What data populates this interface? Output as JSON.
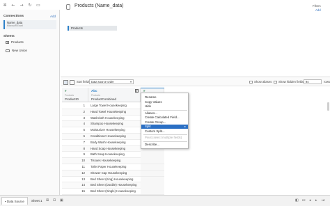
{
  "toolbar": {
    "icons": [
      "logo-icon",
      "back-icon",
      "forward-icon",
      "refresh-icon",
      "save-icon"
    ]
  },
  "left_pane": {
    "connections_title": "Connections",
    "connections_add": "Add",
    "connection": {
      "name": "Name_data",
      "type": "Microsoft Excel"
    },
    "sheets_title": "Sheets",
    "sheets": [
      "Products"
    ],
    "new_union": "New Union"
  },
  "header": {
    "title": "Products (Name_data)",
    "filters_label": "Filters",
    "filters_add": "Add"
  },
  "canvas": {
    "table_pill": "Products"
  },
  "grid_toolbar": {
    "sort_label": "Sort fields",
    "sort_value": "Data source order",
    "show_aliases": "Show aliases",
    "show_hidden": "Show hidden fields",
    "rows_value": "94",
    "rows_label": "rows"
  },
  "grid": {
    "columns": [
      {
        "type": "#",
        "source": "Products",
        "name": "ProductID"
      },
      {
        "type": "Abc",
        "source": "Products",
        "name": "ProductCombined"
      },
      {
        "type": "#",
        "source": "",
        "name": ""
      }
    ],
    "rows": [
      {
        "id": "1",
        "product": "Large Towel Housekeeping"
      },
      {
        "id": "2",
        "product": "Hand Towel Housekeeping"
      },
      {
        "id": "3",
        "product": "Washcloth Housekeeping"
      },
      {
        "id": "4",
        "product": "Shampoo Housekeeping"
      },
      {
        "id": "5",
        "product": "Moisturizer Housekeeping"
      },
      {
        "id": "6",
        "product": "Conditioner Housekeeping"
      },
      {
        "id": "7",
        "product": "Body Wash Housekeeping"
      },
      {
        "id": "8",
        "product": "Hand Soap Housekeeping"
      },
      {
        "id": "9",
        "product": "Bath Soap Housekeeping"
      },
      {
        "id": "10",
        "product": "Tissues Housekeeping"
      },
      {
        "id": "11",
        "product": "Toilet Paper Housekeeping"
      },
      {
        "id": "12",
        "product": "Shower Cap Housekeeping"
      },
      {
        "id": "13",
        "product": "Bed Sheet (King) Housekeeping"
      },
      {
        "id": "14",
        "product": "Bed Sheet (Double) Housekeeping"
      },
      {
        "id": "15",
        "product": "Bed Sheet (Single) Housekeeping"
      }
    ]
  },
  "context_menu": {
    "items": [
      "Rename",
      "Copy Values",
      "Hide",
      "Aliases...",
      "Create Calculated Field...",
      "Create Group...",
      "Split",
      "Custom Split...",
      "Pivot (select multiple fields)",
      "Describe..."
    ]
  },
  "bottom_bar": {
    "data_source_tab": "Data Source",
    "sheet_tab": "Sheet 1"
  }
}
